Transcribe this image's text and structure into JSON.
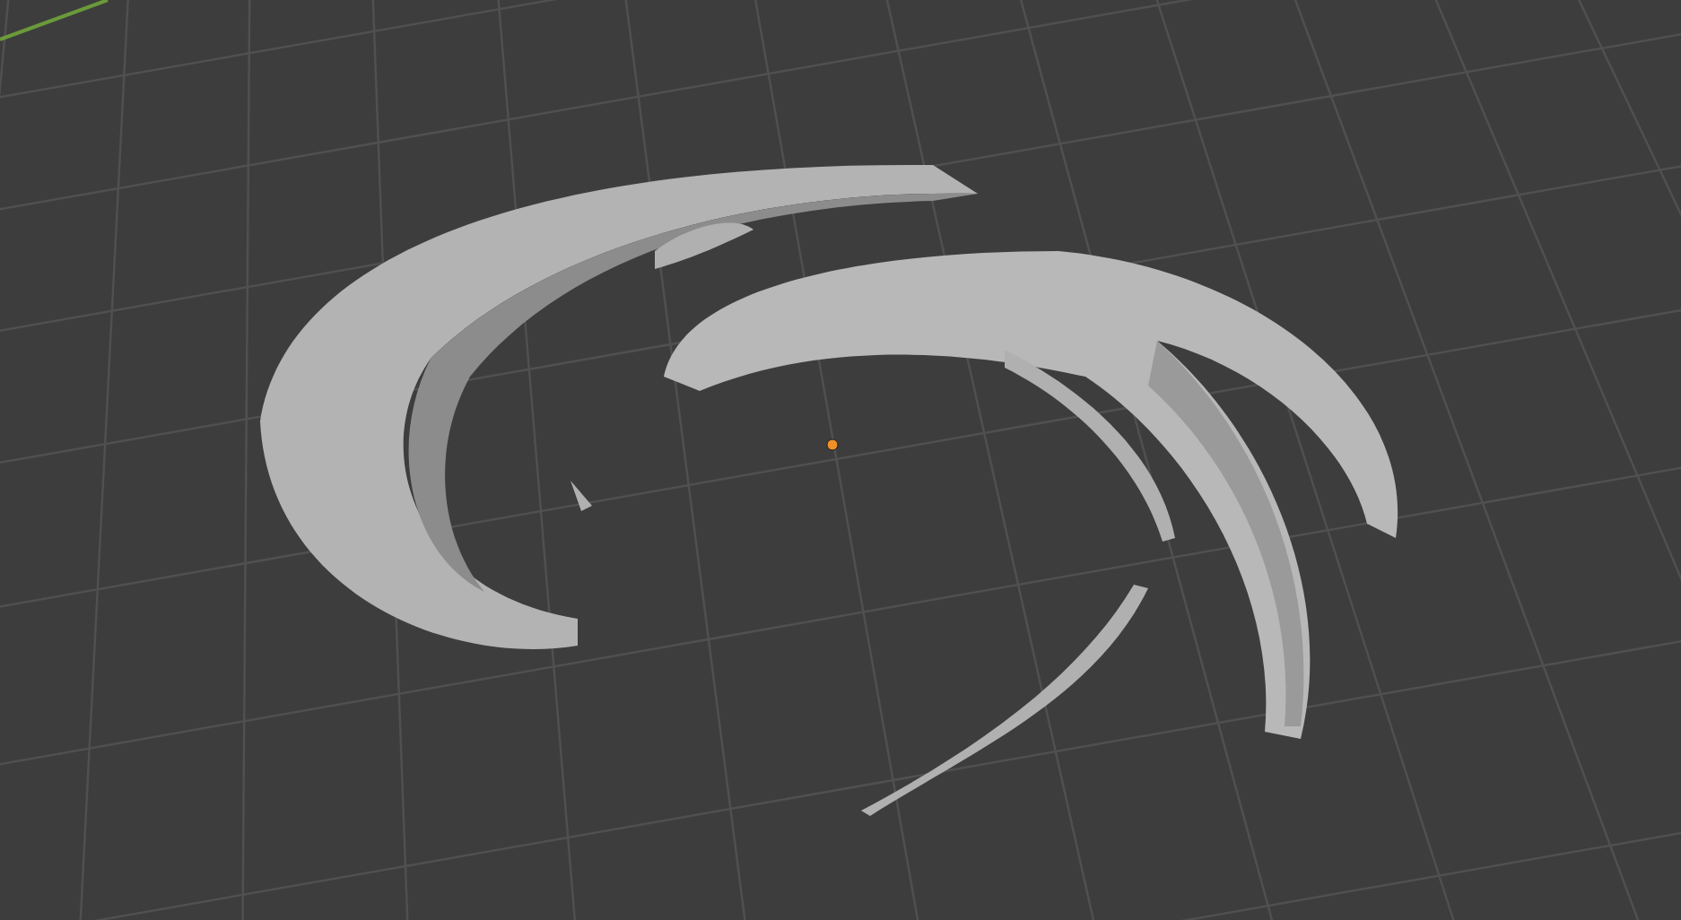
{
  "viewport": {
    "grid_visible": true,
    "axis_line_visible": true,
    "origin_visible": true
  }
}
